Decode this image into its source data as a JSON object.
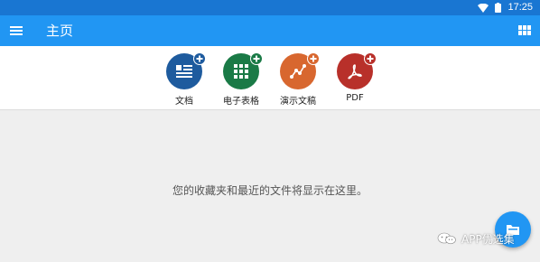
{
  "status_bar": {
    "time": "17:25",
    "icons": [
      "wifi-icon",
      "battery-icon"
    ]
  },
  "app_bar": {
    "title": "主页",
    "menu_icon": "hamburger-menu-icon",
    "view_icon": "grid-view-icon"
  },
  "quick_create": [
    {
      "label": "文档",
      "icon": "document-icon",
      "color": "#1e5b9e",
      "plus_color": "#1e5b9e"
    },
    {
      "label": "电子表格",
      "icon": "spreadsheet-icon",
      "color": "#1a7a46",
      "plus_color": "#1a7a46"
    },
    {
      "label": "演示文稿",
      "icon": "presentation-icon",
      "color": "#d8672f",
      "plus_color": "#d8672f"
    },
    {
      "label": "PDF",
      "icon": "pdf-icon",
      "color": "#b8302a",
      "plus_color": "#b8302a"
    }
  ],
  "empty_state": {
    "message": "您的收藏夹和最近的文件将显示在这里。"
  },
  "fab": {
    "icon": "open-folder-icon",
    "color": "#2196f3"
  },
  "watermark": {
    "text": "APP优选集"
  }
}
